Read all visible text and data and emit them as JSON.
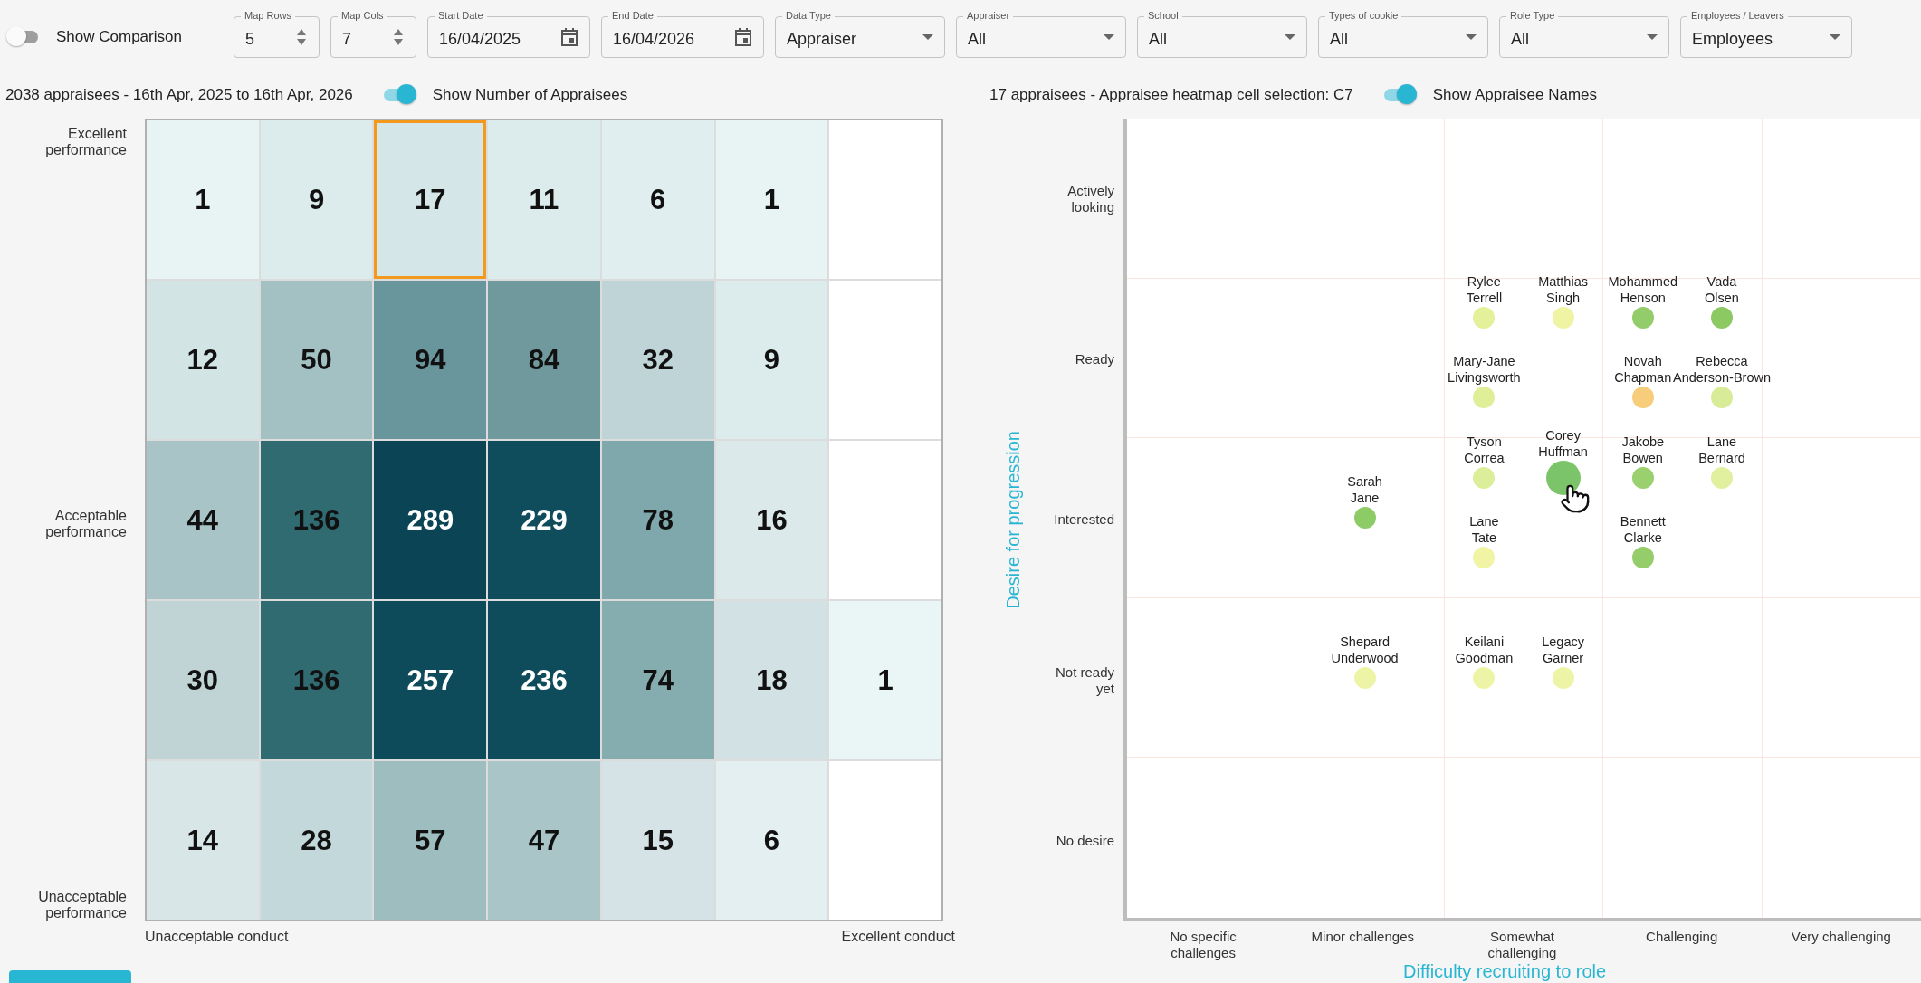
{
  "toolbar": {
    "comparison_toggle": {
      "label": "Show Comparison",
      "on": false
    },
    "filters": [
      {
        "kind": "number",
        "label": "Map Rows",
        "value": "5"
      },
      {
        "kind": "number",
        "label": "Map Cols",
        "value": "7"
      },
      {
        "kind": "date",
        "label": "Start Date",
        "value": "16/04/2025"
      },
      {
        "kind": "date",
        "label": "End Date",
        "value": "16/04/2026"
      },
      {
        "kind": "select",
        "label": "Data Type",
        "value": "Appraiser"
      },
      {
        "kind": "select",
        "label": "Appraiser",
        "value": "All"
      },
      {
        "kind": "select",
        "label": "School",
        "value": "All"
      },
      {
        "kind": "select",
        "label": "Types of cookie",
        "value": "All"
      },
      {
        "kind": "select",
        "label": "Role Type",
        "value": "All"
      },
      {
        "kind": "select",
        "label": "Employees / Leavers",
        "value": "Employees"
      }
    ]
  },
  "heatmap": {
    "summary": "2038 appraisees - 16th Apr, 2025 to 16th Apr, 2026",
    "toggle": {
      "label": "Show Number of Appraisees",
      "on": true
    },
    "y_labels": [
      "Excellent performance",
      "Acceptable performance",
      "Unacceptable performance"
    ],
    "x_labels": [
      "Unacceptable conduct",
      "Excellent conduct"
    ],
    "rows": [
      {
        "cells": [
          {
            "count": "1",
            "color": "#e8f4f4",
            "selected": false
          },
          {
            "count": "9",
            "color": "#dcecec",
            "selected": false
          },
          {
            "count": "17",
            "color": "#d5e6e8",
            "selected": true
          },
          {
            "count": "11",
            "color": "#dcecec",
            "selected": false
          },
          {
            "count": "6",
            "color": "#e0eeef",
            "selected": false
          },
          {
            "count": "1",
            "color": "#e8f4f4",
            "selected": false
          },
          {
            "color": "#ffffff",
            "selected": false
          }
        ]
      },
      {
        "cells": [
          {
            "count": "12",
            "color": "#d3e4e5",
            "selected": false
          },
          {
            "count": "50",
            "color": "#a3c1c3",
            "selected": false
          },
          {
            "count": "94",
            "color": "#69969c",
            "selected": false
          },
          {
            "count": "84",
            "color": "#70999e",
            "selected": false
          },
          {
            "count": "32",
            "color": "#bed4d6",
            "selected": false
          },
          {
            "count": "9",
            "color": "#dcecec",
            "selected": false
          },
          {
            "color": "#ffffff",
            "selected": false
          }
        ]
      },
      {
        "cells": [
          {
            "count": "44",
            "color": "#a8c4c6",
            "selected": false
          },
          {
            "count": "136",
            "color": "#2f6b71",
            "selected": false
          },
          {
            "count": "289",
            "color": "#0a4455",
            "selected": false
          },
          {
            "count": "229",
            "color": "#0f4d5c",
            "selected": false
          },
          {
            "count": "78",
            "color": "#7ea8ab",
            "selected": false
          },
          {
            "count": "16",
            "color": "#dce9ea",
            "selected": false
          },
          {
            "color": "#ffffff",
            "selected": false
          }
        ]
      },
      {
        "cells": [
          {
            "count": "30",
            "color": "#c0d4d6",
            "selected": false
          },
          {
            "count": "136",
            "color": "#2f6b71",
            "selected": false
          },
          {
            "count": "257",
            "color": "#0d4a5a",
            "selected": false
          },
          {
            "count": "236",
            "color": "#0f4c5b",
            "selected": false
          },
          {
            "count": "74",
            "color": "#85adb0",
            "selected": false
          },
          {
            "count": "18",
            "color": "#d2e2e4",
            "selected": false
          },
          {
            "count": "1",
            "color": "#eaf5f5",
            "selected": false
          }
        ]
      },
      {
        "cells": [
          {
            "count": "14",
            "color": "#d8e6e8",
            "selected": false
          },
          {
            "count": "28",
            "color": "#c3d8da",
            "selected": false
          },
          {
            "count": "57",
            "color": "#9ebdbf",
            "selected": false
          },
          {
            "count": "47",
            "color": "#aac5c7",
            "selected": false
          },
          {
            "count": "15",
            "color": "#d6e3e6",
            "selected": false
          },
          {
            "count": "6",
            "color": "#e4eff1",
            "selected": false
          },
          {
            "color": "#ffffff",
            "selected": false
          }
        ]
      }
    ]
  },
  "scatter": {
    "summary": "17 appraisees - Appraisee heatmap cell selection: C7",
    "toggle": {
      "label": "Show Appraisee Names",
      "on": true
    },
    "y_title": "Desire for progression",
    "x_title": "Difficulty recruiting to role",
    "x_labels": [
      "No specific challenges",
      "Minor challenges",
      "Somewhat challenging",
      "Challenging",
      "Very challenging"
    ],
    "rows": [
      {
        "label": "Actively looking",
        "cells": [
          {},
          {},
          {},
          {},
          {}
        ]
      },
      {
        "label": "Ready",
        "cells": [
          {},
          {},
          {
            "people": [
              {
                "name": "Rylee\nTerrell",
                "color": "#e4f09a",
                "hovered": false
              },
              {
                "name": "Matthias\nSingh",
                "color": "#eef4a4",
                "hovered": false
              },
              {
                "name": "Mary-Jane\nLivingsworth",
                "color": "#dfee99",
                "hovered": false
              }
            ]
          },
          {
            "people": [
              {
                "name": "Mohammed\nHenson",
                "color": "#93cc6a",
                "hovered": false
              },
              {
                "name": "Vada\nOlsen",
                "color": "#8cc963",
                "hovered": false
              },
              {
                "name": "Novah\nChapman",
                "color": "#f7cc7a",
                "hovered": false
              },
              {
                "name": "Rebecca\nAnderson-Brown",
                "color": "#d8ec98",
                "hovered": false
              }
            ]
          },
          {}
        ]
      },
      {
        "label": "Interested",
        "cells": [
          {},
          {
            "people": [
              {
                "name": "Sarah\nJane",
                "color": "#8ccb65",
                "hovered": false
              }
            ]
          },
          {
            "people": [
              {
                "name": "Tyson\nCorrea",
                "color": "#dcee9a",
                "hovered": false
              },
              {
                "name": "Corey\nHuffman",
                "color": "#7cc46a",
                "hovered": true
              },
              {
                "name": "Lane\nTate",
                "color": "#f0f4a4",
                "hovered": false
              }
            ]
          },
          {
            "people": [
              {
                "name": "Jakobe\nBowen",
                "color": "#9ad06e",
                "hovered": false
              },
              {
                "name": "Lane\nBernard",
                "color": "#e0f09e",
                "hovered": false
              },
              {
                "name": "Bennett\nClarke",
                "color": "#94cd6a",
                "hovered": false
              }
            ]
          },
          {}
        ]
      },
      {
        "label": "Not ready yet",
        "cells": [
          {},
          {
            "people": [
              {
                "name": "Shepard\nUnderwood",
                "color": "#eef4a6",
                "hovered": false
              }
            ]
          },
          {
            "people": [
              {
                "name": "Keilani\nGoodman",
                "color": "#eef4a6",
                "hovered": false
              },
              {
                "name": "Legacy\nGarner",
                "color": "#eef4a6",
                "hovered": false
              }
            ]
          },
          {},
          {}
        ]
      },
      {
        "label": "No desire",
        "cells": [
          {},
          {},
          {},
          {},
          {}
        ]
      }
    ]
  }
}
